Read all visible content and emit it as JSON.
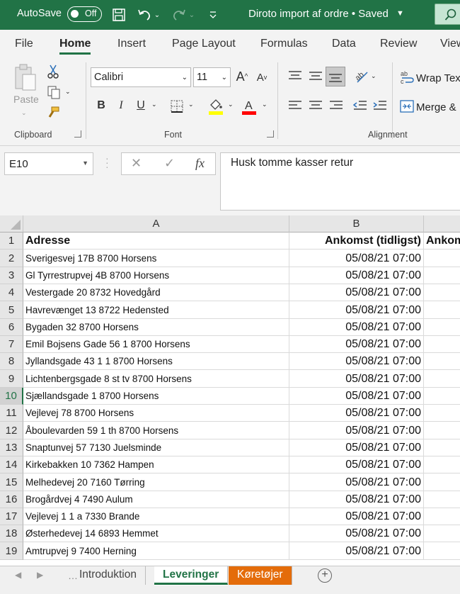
{
  "titlebar": {
    "autosave_label": "AutoSave",
    "autosave_state": "Off",
    "document_title": "Diroto import af ordre • Saved"
  },
  "ribbon_tabs": [
    "File",
    "Home",
    "Insert",
    "Page Layout",
    "Formulas",
    "Data",
    "Review",
    "View"
  ],
  "ribbon": {
    "clipboard": {
      "label": "Clipboard",
      "paste_label": "Paste"
    },
    "font": {
      "label": "Font",
      "font_name": "Calibri",
      "font_size": "11",
      "bold": "B",
      "italic": "I",
      "underline": "U"
    },
    "alignment": {
      "label": "Alignment",
      "wrap_text": "Wrap Text",
      "merge": "Merge &"
    },
    "colors": {
      "brand": "#217346",
      "highlight": "#ffff00",
      "font_color": "#ff0000",
      "orange_tab": "#e46c0a"
    }
  },
  "formula_bar": {
    "name_box": "E10",
    "fx": "fx",
    "content": "Husk tomme kasser retur"
  },
  "grid": {
    "columns": [
      "A",
      "B"
    ],
    "rows": [
      {
        "n": "1",
        "a": "Adresse",
        "b": "Ankomst (tidligst)",
        "c": "Ankom"
      },
      {
        "n": "2",
        "a": "Sverigesvej 17B   8700 Horsens",
        "b": "05/08/21 07:00",
        "c": ""
      },
      {
        "n": "3",
        "a": "Gl Tyrrestrupvej 4B   8700 Horsens",
        "b": "05/08/21 07:00",
        "c": ""
      },
      {
        "n": "4",
        "a": "Vestergade 20   8732 Hovedgård",
        "b": "05/08/21 07:00",
        "c": ""
      },
      {
        "n": "5",
        "a": "Havrevænget 13   8722 Hedensted",
        "b": "05/08/21 07:00",
        "c": ""
      },
      {
        "n": "6",
        "a": "Bygaden 32   8700 Horsens",
        "b": "05/08/21 07:00",
        "c": ""
      },
      {
        "n": "7",
        "a": "Emil Bojsens Gade 56 1  8700 Horsens",
        "b": "05/08/21 07:00",
        "c": ""
      },
      {
        "n": "8",
        "a": "Jyllandsgade 43 1 1 8700 Horsens",
        "b": "05/08/21 07:00",
        "c": ""
      },
      {
        "n": "9",
        "a": "Lichtenbergsgade 8 st tv 8700 Horsens",
        "b": "05/08/21 07:00",
        "c": ""
      },
      {
        "n": "10",
        "a": "Sjællandsgade 1   8700 Horsens",
        "b": "05/08/21 07:00",
        "c": ""
      },
      {
        "n": "11",
        "a": "Vejlevej 78   8700 Horsens",
        "b": "05/08/21 07:00",
        "c": ""
      },
      {
        "n": "12",
        "a": "Åboulevarden 59 1 th 8700 Horsens",
        "b": "05/08/21 07:00",
        "c": ""
      },
      {
        "n": "13",
        "a": "Snaptunvej 57   7130 Juelsminde",
        "b": "05/08/21 07:00",
        "c": ""
      },
      {
        "n": "14",
        "a": "Kirkebakken 10   7362 Hampen",
        "b": "05/08/21 07:00",
        "c": ""
      },
      {
        "n": "15",
        "a": "Melhedevej 20   7160 Tørring",
        "b": "05/08/21 07:00",
        "c": ""
      },
      {
        "n": "16",
        "a": "Brogårdvej 4   7490 Aulum",
        "b": "05/08/21 07:00",
        "c": ""
      },
      {
        "n": "17",
        "a": "Vejlevej 1 1 a 7330 Brande",
        "b": "05/08/21 07:00",
        "c": ""
      },
      {
        "n": "18",
        "a": "Østerhedevej 14   6893 Hemmet",
        "b": "05/08/21 07:00",
        "c": ""
      },
      {
        "n": "19",
        "a": "Amtrupvej 9   7400 Herning",
        "b": "05/08/21 07:00",
        "c": ""
      }
    ]
  },
  "sheets": [
    {
      "name": "Introduktion",
      "state": "normal"
    },
    {
      "name": "Leveringer",
      "state": "active"
    },
    {
      "name": "Køretøjer",
      "state": "orange"
    }
  ]
}
